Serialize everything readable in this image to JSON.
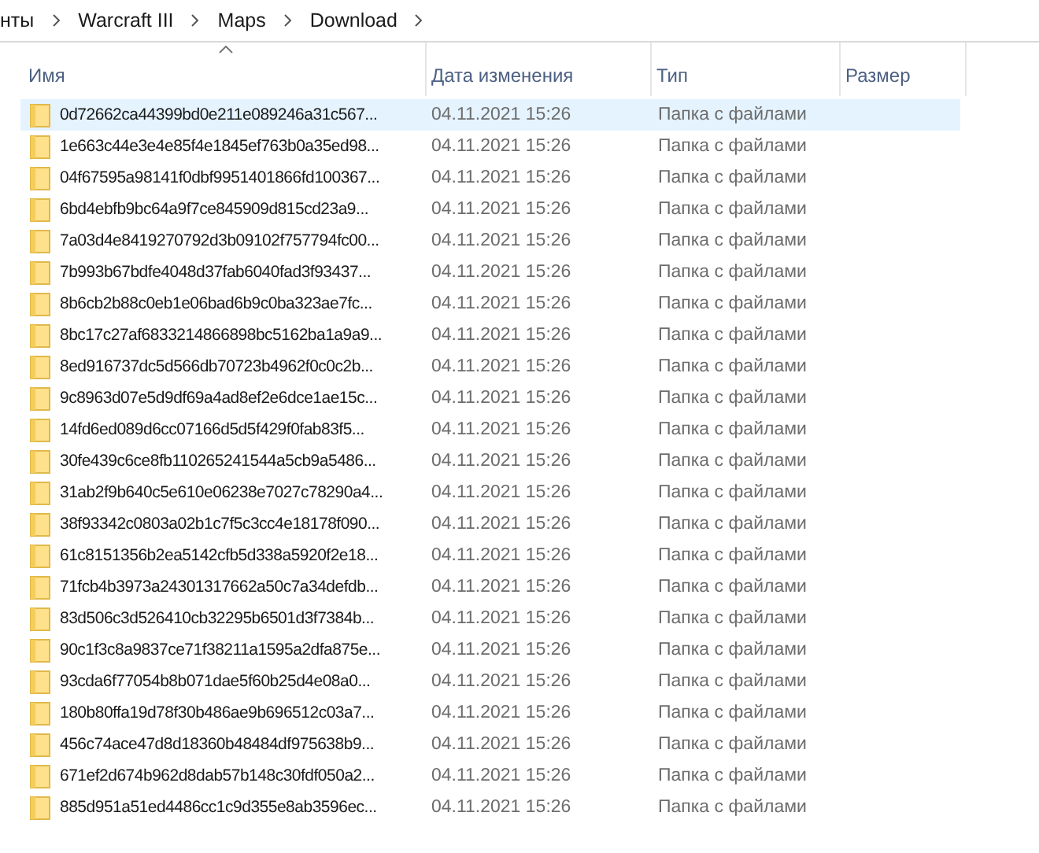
{
  "breadcrumb": [
    {
      "label": "нты"
    },
    {
      "label": "Warcraft III"
    },
    {
      "label": "Maps"
    },
    {
      "label": "Download"
    }
  ],
  "columns": [
    {
      "label": "Имя",
      "sorted": true
    },
    {
      "label": "Дата изменения",
      "sorted": false
    },
    {
      "label": "Тип",
      "sorted": false
    },
    {
      "label": "Размер",
      "sorted": false
    }
  ],
  "rows": [
    {
      "name": "0d72662ca44399bd0e211e089246a31c567...",
      "modified": "04.11.2021 15:26",
      "type": "Папка с файлами",
      "selected": true
    },
    {
      "name": "1e663c44e3e4e85f4e1845ef763b0a35ed98...",
      "modified": "04.11.2021 15:26",
      "type": "Папка с файлами",
      "selected": false
    },
    {
      "name": "04f67595a98141f0dbf9951401866fd100367...",
      "modified": "04.11.2021 15:26",
      "type": "Папка с файлами",
      "selected": false
    },
    {
      "name": "6bd4ebfb9bc64a9f7ce845909d815cd23a9...",
      "modified": "04.11.2021 15:26",
      "type": "Папка с файлами",
      "selected": false
    },
    {
      "name": "7a03d4e8419270792d3b09102f757794fc00...",
      "modified": "04.11.2021 15:26",
      "type": "Папка с файлами",
      "selected": false
    },
    {
      "name": "7b993b67bdfe4048d37fab6040fad3f93437...",
      "modified": "04.11.2021 15:26",
      "type": "Папка с файлами",
      "selected": false
    },
    {
      "name": "8b6cb2b88c0eb1e06bad6b9c0ba323ae7fc...",
      "modified": "04.11.2021 15:26",
      "type": "Папка с файлами",
      "selected": false
    },
    {
      "name": "8bc17c27af6833214866898bc5162ba1a9a9...",
      "modified": "04.11.2021 15:26",
      "type": "Папка с файлами",
      "selected": false
    },
    {
      "name": "8ed916737dc5d566db70723b4962f0c0c2b...",
      "modified": "04.11.2021 15:26",
      "type": "Папка с файлами",
      "selected": false
    },
    {
      "name": "9c8963d07e5d9df69a4ad8ef2e6dce1ae15c...",
      "modified": "04.11.2021 15:26",
      "type": "Папка с файлами",
      "selected": false
    },
    {
      "name": "14fd6ed089d6cc07166d5d5f429f0fab83f5...",
      "modified": "04.11.2021 15:26",
      "type": "Папка с файлами",
      "selected": false
    },
    {
      "name": "30fe439c6ce8fb110265241544a5cb9a5486...",
      "modified": "04.11.2021 15:26",
      "type": "Папка с файлами",
      "selected": false
    },
    {
      "name": "31ab2f9b640c5e610e06238e7027c78290a4...",
      "modified": "04.11.2021 15:26",
      "type": "Папка с файлами",
      "selected": false
    },
    {
      "name": "38f93342c0803a02b1c7f5c3cc4e18178f090...",
      "modified": "04.11.2021 15:26",
      "type": "Папка с файлами",
      "selected": false
    },
    {
      "name": "61c8151356b2ea5142cfb5d338a5920f2e18...",
      "modified": "04.11.2021 15:26",
      "type": "Папка с файлами",
      "selected": false
    },
    {
      "name": "71fcb4b3973a24301317662a50c7a34defdb...",
      "modified": "04.11.2021 15:26",
      "type": "Папка с файлами",
      "selected": false
    },
    {
      "name": "83d506c3d526410cb32295b6501d3f7384b...",
      "modified": "04.11.2021 15:26",
      "type": "Папка с файлами",
      "selected": false
    },
    {
      "name": "90c1f3c8a9837ce71f38211a1595a2dfa875e...",
      "modified": "04.11.2021 15:26",
      "type": "Папка с файлами",
      "selected": false
    },
    {
      "name": "93cda6f77054b8b071dae5f60b25d4e08a0...",
      "modified": "04.11.2021 15:26",
      "type": "Папка с файлами",
      "selected": false
    },
    {
      "name": "180b80ffa19d78f30b486ae9b696512c03a7...",
      "modified": "04.11.2021 15:26",
      "type": "Папка с файлами",
      "selected": false
    },
    {
      "name": "456c74ace47d8d18360b48484df975638b9...",
      "modified": "04.11.2021 15:26",
      "type": "Папка с файлами",
      "selected": false
    },
    {
      "name": "671ef2d674b962d8dab57b148c30fdf050a2...",
      "modified": "04.11.2021 15:26",
      "type": "Папка с файлами",
      "selected": false
    },
    {
      "name": "885d951a51ed4486cc1c9d355e8ab3596ec...",
      "modified": "04.11.2021 15:26",
      "type": "Папка с файлами",
      "selected": false
    }
  ]
}
